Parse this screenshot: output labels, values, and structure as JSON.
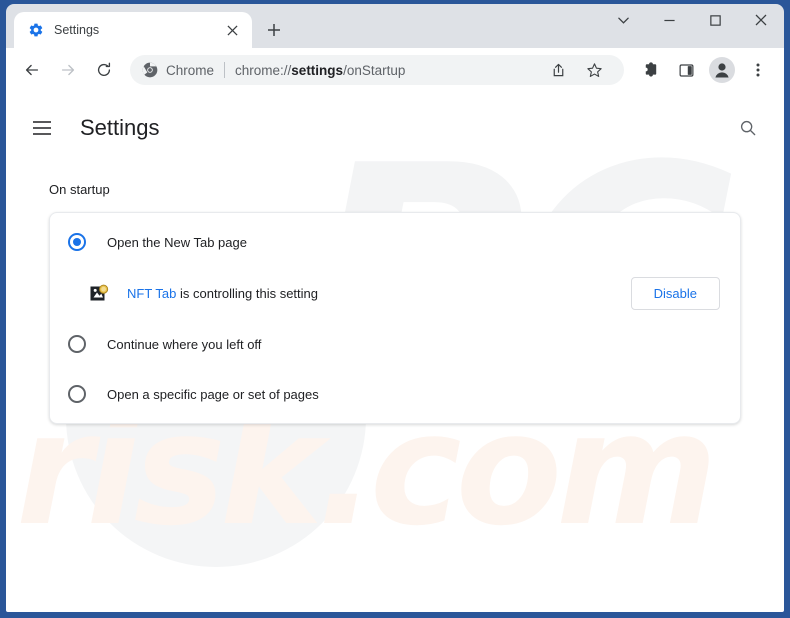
{
  "window": {
    "controls": {
      "tab_search_label": "chevron-down",
      "minimize_label": "minimize",
      "maximize_label": "maximize",
      "close_label": "close"
    }
  },
  "tabs": [
    {
      "title": "Settings",
      "favicon": "gear-icon",
      "close_label": "×",
      "active": true
    }
  ],
  "new_tab": {
    "label": "+"
  },
  "toolbar": {
    "back_label": "back",
    "forward_label": "forward",
    "reload_label": "reload",
    "omnibox": {
      "brand_label": "Chrome",
      "url_prefix": "chrome://",
      "url_bold": "settings",
      "url_suffix": "/onStartup",
      "share_label": "share",
      "bookmark_label": "bookmark"
    },
    "extensions_label": "extensions",
    "side_panel_label": "side panel",
    "profile_label": "profile",
    "menu_label": "more options"
  },
  "settings": {
    "menu_label": "Main menu",
    "title": "Settings",
    "search_label": "Search settings"
  },
  "on_startup": {
    "heading": "On startup",
    "options": [
      {
        "label": "Open the New Tab page",
        "selected": true
      },
      {
        "label": "Continue where you left off",
        "selected": false
      },
      {
        "label": "Open a specific page or set of pages",
        "selected": false
      }
    ],
    "extension_notice": {
      "icon": "nft-tab-extension-icon",
      "link_text": "NFT Tab",
      "rest_text": " is controlling this setting",
      "disable_button": "Disable"
    }
  },
  "watermark": {
    "primary": "PC",
    "secondary": "risk.com"
  },
  "colors": {
    "frame": "#2a5699",
    "accent": "#1a73e8",
    "tab_strip": "#dee1e6",
    "omnibox": "#f1f3f4",
    "text": "#202124",
    "muted_text": "#5f6368"
  }
}
